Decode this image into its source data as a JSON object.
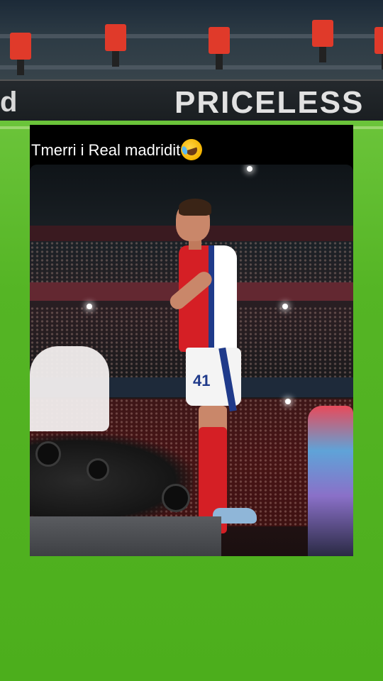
{
  "background": {
    "ad_board_left": "d",
    "ad_board_text": "PRICELESS"
  },
  "post": {
    "caption": "Tmerri i Real madridit",
    "emoji": "rolling-on-floor-laughing"
  },
  "photo": {
    "player_number": "41"
  },
  "colors": {
    "pitch_green": "#4cae1c",
    "seat_red": "#e03a2a",
    "kit_red": "#d51f25",
    "kit_blue": "#1f3a8a"
  }
}
